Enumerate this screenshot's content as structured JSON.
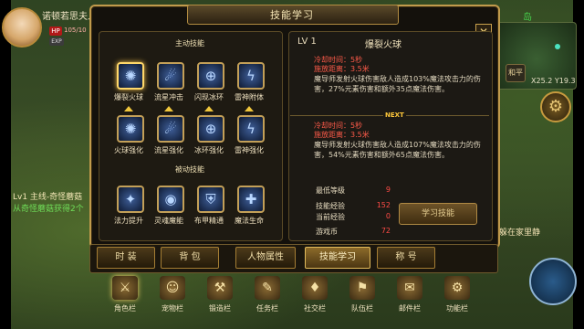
{
  "hud": {
    "player_name": "诺顿若思夫人",
    "hp_tag": "HP",
    "exp_tag": "EXP",
    "hp_text": "105/10",
    "quest_line1": "Lv1 主线-奇怪蘑菇",
    "quest_line2": "从奇怪蘑菇获得2个",
    "map_label": "岛",
    "coords": "X25.2 Y19.3",
    "side_button": "和平",
    "chat_text": "牧躲在家里静"
  },
  "panel": {
    "title": "技能学习",
    "close": "✕",
    "active_section_title": "主动技能",
    "passive_section_title": "被动技能",
    "active_skills_row1": [
      {
        "label": "爆裂火球",
        "icon": "fireball-icon",
        "glyph": "✺"
      },
      {
        "label": "流星冲击",
        "icon": "meteor-icon",
        "glyph": "☄"
      },
      {
        "label": "闪现冰环",
        "icon": "ice-ring-icon",
        "glyph": "⊕"
      },
      {
        "label": "雷神附体",
        "icon": "thunder-icon",
        "glyph": "ϟ"
      }
    ],
    "active_skills_row2": [
      {
        "label": "火球强化",
        "icon": "fireball-boost-icon",
        "glyph": "✺"
      },
      {
        "label": "流星强化",
        "icon": "meteor-boost-icon",
        "glyph": "☄"
      },
      {
        "label": "冰环强化",
        "icon": "ice-boost-icon",
        "glyph": "⊕"
      },
      {
        "label": "雷神强化",
        "icon": "thunder-boost-icon",
        "glyph": "ϟ"
      }
    ],
    "passive_skills": [
      {
        "label": "法力提升",
        "icon": "mana-up-icon",
        "glyph": "✦"
      },
      {
        "label": "灵魂魔能",
        "icon": "soul-magic-icon",
        "glyph": "◉"
      },
      {
        "label": "布甲精通",
        "icon": "cloth-armor-icon",
        "glyph": "⛨"
      },
      {
        "label": "魔法生命",
        "icon": "magic-life-icon",
        "glyph": "✚"
      }
    ],
    "detail": {
      "level": "LV 1",
      "skill_name": "爆裂火球",
      "current": {
        "cooldown": "冷却时间：5秒",
        "range": "施放距离：3.5米",
        "description": "魔导师发射火球伤害敌人造成103%魔法攻击力的伤害，27%元素伤害和额外35点魔法伤害。"
      },
      "next_label": "NEXT",
      "next": {
        "cooldown": "冷却时间：5秒",
        "range": "施放距离：3.5米",
        "description": "魔导师发射火球伤害敌人造成107%魔法攻击力的伤害，54%元素伤害和额外65点魔法伤害。"
      },
      "requirements": [
        {
          "label": "最低等级",
          "value": "9"
        },
        {
          "label": "技能经验",
          "value": "152"
        },
        {
          "label": "当前经验",
          "value": "0"
        },
        {
          "label": "游戏币",
          "value": "72"
        }
      ],
      "learn_button": "学习技能"
    }
  },
  "menu_tabs": [
    {
      "label": "时  装",
      "active": false
    },
    {
      "label": "背  包",
      "active": false
    },
    {
      "label": "人物属性",
      "active": false
    },
    {
      "label": "技能学习",
      "active": true
    },
    {
      "label": "称  号",
      "active": false
    }
  ],
  "bottom_nav": [
    {
      "label": "角色栏",
      "icon": "character-icon",
      "glyph": "⚔"
    },
    {
      "label": "宠物栏",
      "icon": "pet-icon",
      "glyph": "☺"
    },
    {
      "label": "锻造栏",
      "icon": "forge-icon",
      "glyph": "⚒"
    },
    {
      "label": "任务栏",
      "icon": "quest-icon",
      "glyph": "✎"
    },
    {
      "label": "社交栏",
      "icon": "social-icon",
      "glyph": "♦"
    },
    {
      "label": "队伍栏",
      "icon": "team-icon",
      "glyph": "⚑"
    },
    {
      "label": "邮件栏",
      "icon": "mail-icon",
      "glyph": "✉"
    },
    {
      "label": "功能栏",
      "icon": "function-icon",
      "glyph": "⚙"
    }
  ]
}
